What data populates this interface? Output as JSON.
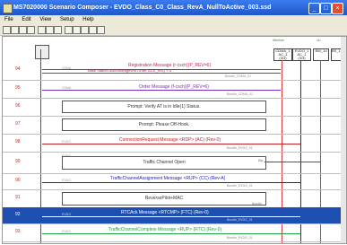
{
  "window": {
    "title": "MS7020000 Scenario Composer - EVDO_Class_C0_Class_RevA_NullToActive_003.ssd",
    "min": "_",
    "max": "□",
    "close": "×"
  },
  "menu": [
    "File",
    "Edit",
    "View",
    "Setup",
    "Help"
  ],
  "nodes": [
    {
      "label": "CDMA_1\nAC_1\n(3/3)"
    },
    {
      "label": "EVDO_1\nAC_1\n(3/3)"
    },
    {
      "label": "BW_1d"
    },
    {
      "label": "BS_1C"
    }
  ],
  "header_tags": [
    "Wireline",
    "Uu"
  ],
  "rows": [
    {
      "num": "94",
      "proto": "CDMA",
      "text": "Registration Message (r-csch)(P_REV=6)",
      "sub": "Base Station Acknowledgment Order, ACK_REQ = 0",
      "note": "Bundle_CDMA_01"
    },
    {
      "num": "95",
      "proto": "CDMA",
      "text": "Order Message (f-csch)(P_REV=6)",
      "note": "Bundle_CDMA_01"
    },
    {
      "num": "96",
      "text": "Prompt: Verify AT is in Idle(1) Status."
    },
    {
      "num": "97",
      "text": "Prompt: Please Off-Hook."
    },
    {
      "num": "98",
      "proto": "EVDO",
      "text": "ConnectionRequest Message <RDP> (AC) (Rev-0)",
      "note": "Bundle_EVDO_01"
    },
    {
      "num": "99",
      "proto": "EVDO",
      "text": "Traffic Channel Open",
      "tag": "Gu"
    },
    {
      "num": "90",
      "proto": "EVDO",
      "text": "TrafficChannelAssignment Message <RUP> (CC) (Rev-A)",
      "note": "Bundle_EVDO_01"
    },
    {
      "num": "91",
      "proto": "EVDO",
      "text": "ReversePilot+MAC",
      "note": "Bundle"
    },
    {
      "num": "92",
      "proto": "EVDO",
      "text": "RTCAck Message <RTCMP> (FTC) (Rev-0)",
      "note": "Bundle_EVDO_01"
    },
    {
      "num": "93",
      "proto": "EVDO",
      "text": "TrafficChannelComplete Message <RUP> (RTC) (Rev-0)",
      "note": "Bundle_EVDO_01"
    }
  ]
}
